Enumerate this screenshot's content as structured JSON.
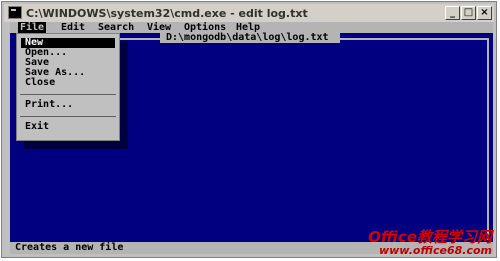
{
  "window": {
    "title": "C:\\WINDOWS\\system32\\cmd.exe - edit log.txt",
    "buttons": {
      "minimize": "_",
      "maximize": "□",
      "close": "×"
    }
  },
  "menubar": {
    "items": [
      "File",
      "Edit",
      "Search",
      "View",
      "Options",
      "Help"
    ]
  },
  "document": {
    "path": "D:\\mongodb\\data\\log\\log.txt"
  },
  "file_menu": {
    "items": [
      "New",
      "Open...",
      "Save",
      "Save As...",
      "Close",
      "Print...",
      "Exit"
    ],
    "selected": "New"
  },
  "statusbar": {
    "text": "Creates a new file"
  },
  "watermark": {
    "line1": "Office教程学习网",
    "line2": "www.office68.com"
  }
}
